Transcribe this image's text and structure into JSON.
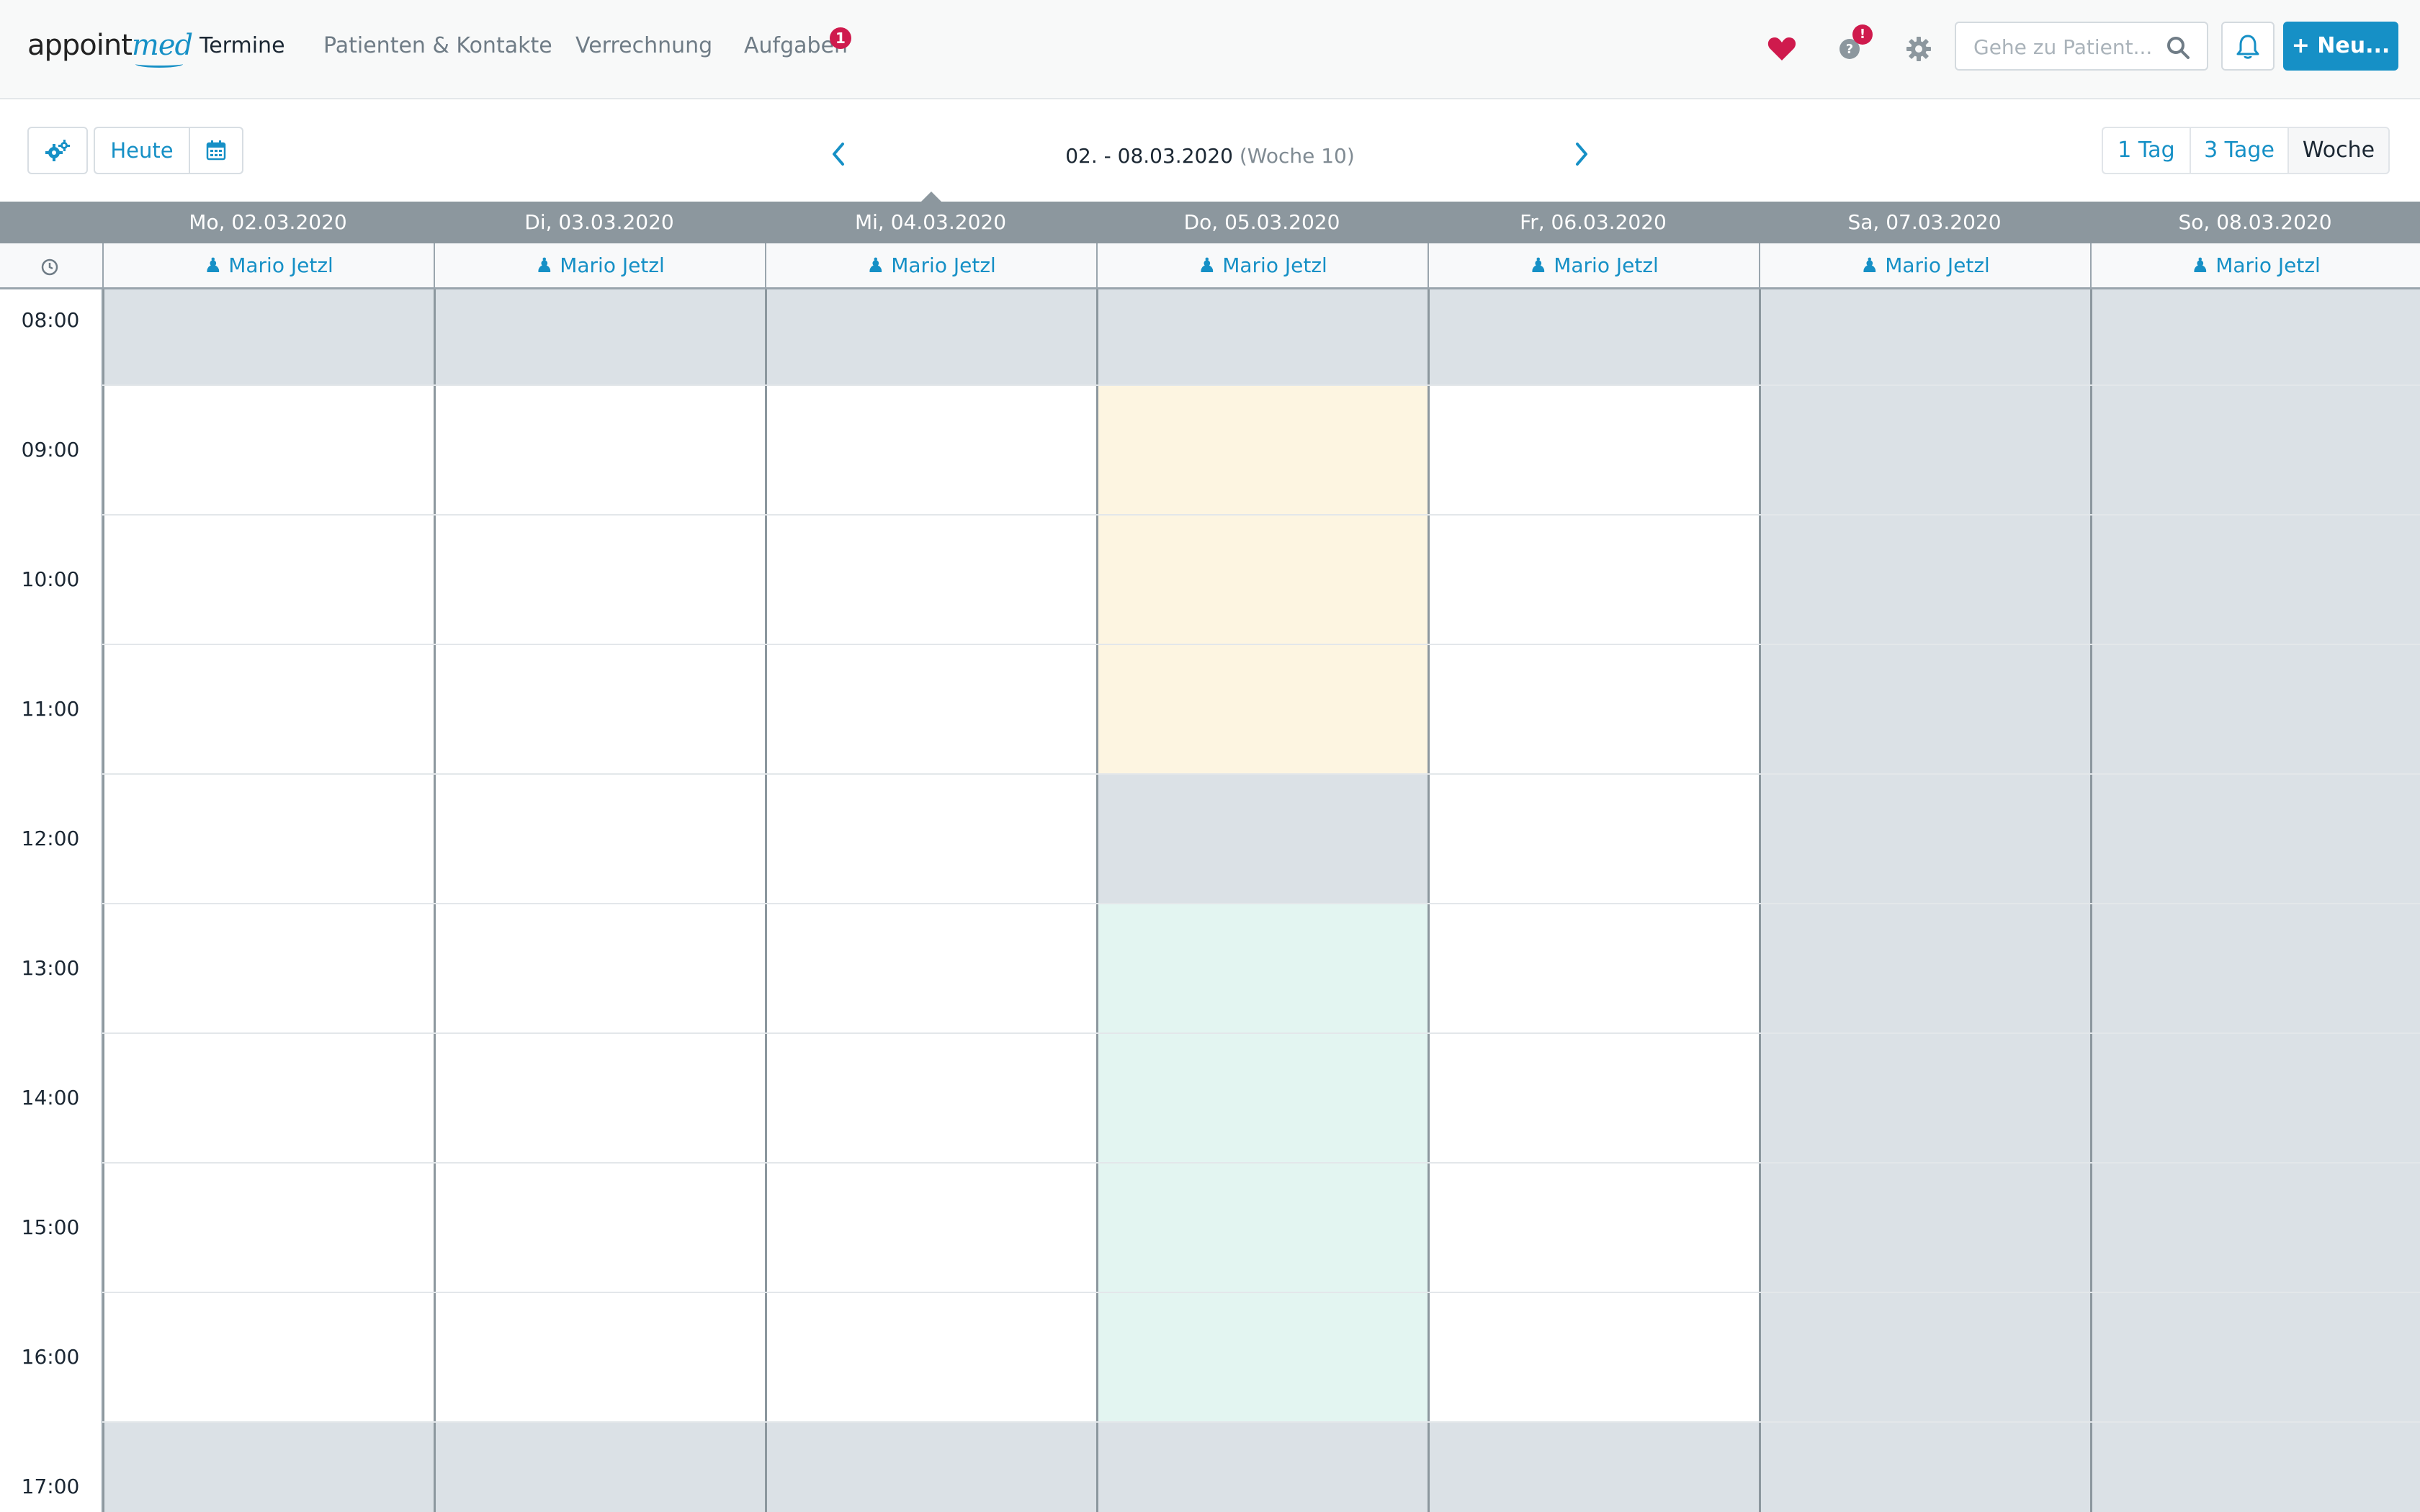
{
  "navbar": {
    "logo_part1": "appoint",
    "logo_part2": "med",
    "items": [
      "Termine",
      "Patienten & Kontakte",
      "Verrechnung",
      "Aufgaben"
    ],
    "tasks_badge": "1",
    "help_badge": "!",
    "search_placeholder": "Gehe zu Patient...",
    "new_button": "+ Neu..."
  },
  "toolbar": {
    "today": "Heute",
    "date_range": "02. - 08.03.2020",
    "week": "(Woche 10)",
    "views": [
      "1 Tag",
      "3 Tage",
      "Woche"
    ],
    "active_view": "Woche"
  },
  "calendar": {
    "days": [
      "Mo, 02.03.2020",
      "Di, 03.03.2020",
      "Mi, 04.03.2020",
      "Do, 05.03.2020",
      "Fr, 06.03.2020",
      "Sa, 07.03.2020",
      "So, 08.03.2020"
    ],
    "today_index": 2,
    "resource": "Mario Jetzl",
    "hours": [
      "08:00",
      "09:00",
      "10:00",
      "11:00",
      "12:00",
      "13:00",
      "14:00",
      "15:00",
      "16:00",
      "17:00"
    ]
  },
  "colors": {
    "accent": "#1690c6",
    "badge": "#cf1a4d",
    "closed": "#dbe1e6",
    "header": "#8c979e",
    "slot_yellow": "#fdf5e1",
    "slot_green": "#e3f5f1"
  }
}
